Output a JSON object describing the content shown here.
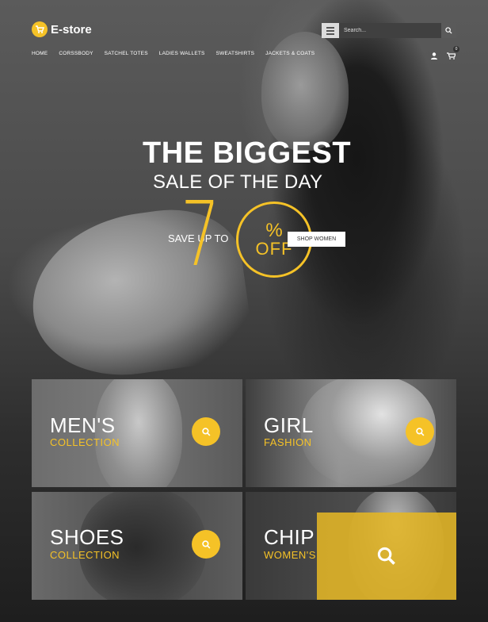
{
  "brand": {
    "name": "E-store",
    "accent": "#f5c227"
  },
  "header": {
    "search_placeholder": "Search...",
    "nav": [
      "HOME",
      "CORSSBODY",
      "SATCHEL TOTES",
      "LADIES WALLETS",
      "SWEATSHIRTS",
      "JACKETS & COATS"
    ],
    "cart_count": "0"
  },
  "hero": {
    "title": "THE BIGGEST",
    "subtitle": "SALE OF THE DAY",
    "save_label": "SAVE UP TO",
    "discount_number": "70",
    "percent_sign": "%",
    "off_label": "OFF",
    "cta_label": "SHOP WOMEN"
  },
  "tiles": [
    {
      "title": "MEN'S",
      "subtitle": "COLLECTION"
    },
    {
      "title": "GIRL",
      "subtitle": "FASHION"
    },
    {
      "title": "SHOES",
      "subtitle": "COLLECTION"
    },
    {
      "title": "CHIP",
      "subtitle": "WOMEN'S"
    }
  ],
  "icons": [
    "menu-icon",
    "search-icon",
    "user-icon",
    "cart-icon",
    "logo-icon"
  ]
}
